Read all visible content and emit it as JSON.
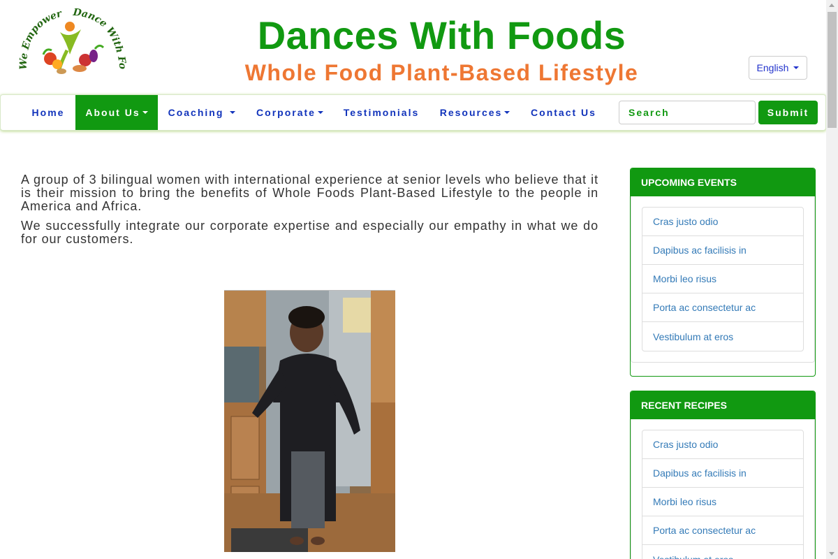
{
  "header": {
    "title": "Dances With Foods",
    "subtitle": "Whole Food Plant-Based Lifestyle",
    "logo_text_top": "We Empower you ! Dance With Foods",
    "language_label": "English"
  },
  "nav": {
    "items": [
      {
        "label": "Home"
      },
      {
        "label": "About Us"
      },
      {
        "label": "Coaching"
      },
      {
        "label": "Corporate"
      },
      {
        "label": "Testimonials"
      },
      {
        "label": "Resources"
      },
      {
        "label": "Contact Us"
      }
    ],
    "search_placeholder": "Search",
    "submit_label": "Submit"
  },
  "main": {
    "paragraphs": [
      "A group of 3 bilingual women with international experience at senior levels who believe that it is their mission to bring the benefits of Whole Foods Plant-Based Lifestyle to the people in America and Africa.",
      "We successfully integrate our corporate expertise and especially our empathy in what we do for our customers."
    ]
  },
  "sidebar": {
    "events": {
      "heading": "UPCOMING EVENTS",
      "items": [
        "Cras justo odio",
        "Dapibus ac facilisis in",
        "Morbi leo risus",
        "Porta ac consectetur ac",
        "Vestibulum at eros"
      ]
    },
    "recipes": {
      "heading": "RECENT RECIPES",
      "items": [
        "Cras justo odio",
        "Dapibus ac facilisis in",
        "Morbi leo risus",
        "Porta ac consectetur ac",
        "Vestibulum at eros"
      ]
    }
  },
  "colors": {
    "brand_green": "#119911",
    "brand_orange": "#ee7733",
    "nav_blue": "#1133bb",
    "link_blue": "#337ab7"
  }
}
